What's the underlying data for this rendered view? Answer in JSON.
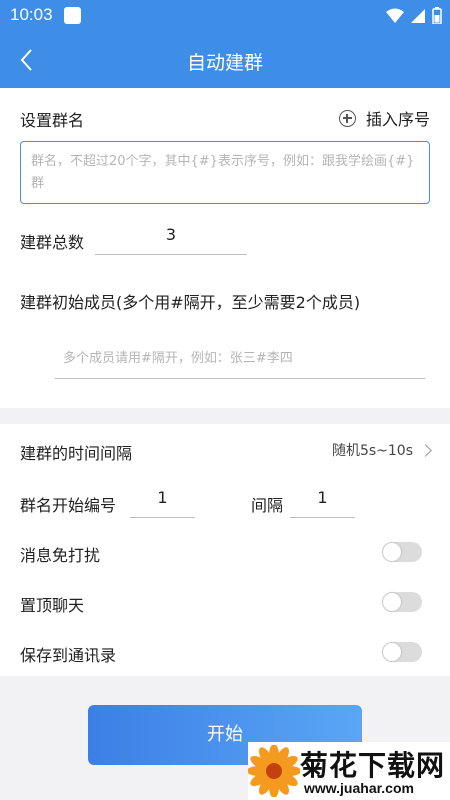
{
  "status_bar": {
    "time": "10:03",
    "icons": [
      "notification-icon",
      "wifi-icon",
      "signal-icon",
      "battery-icon"
    ]
  },
  "app_bar": {
    "title": "自动建群",
    "back_icon": "back-arrow-icon"
  },
  "group_name": {
    "label": "设置群名",
    "insert_label": "插入序号",
    "insert_icon": "plus-circle-icon",
    "placeholder": "群名，不超过20个字，其中{#}表示序号，例如：跟我学绘画{#}群",
    "value": ""
  },
  "total": {
    "label": "建群总数",
    "value": "3"
  },
  "members": {
    "label": "建群初始成员(多个用#隔开，至少需要2个成员)",
    "placeholder": "多个成员请用#隔开，例如：张三#李四"
  },
  "interval": {
    "label": "建群的时间间隔",
    "value": "随机5s~10s"
  },
  "numbering": {
    "start_label": "群名开始编号",
    "start_value": "1",
    "step_label": "间隔",
    "step_value": "1"
  },
  "toggles": [
    {
      "label": "消息免打扰",
      "on": false
    },
    {
      "label": "置顶聊天",
      "on": false
    },
    {
      "label": "保存到通讯录",
      "on": false
    }
  ],
  "start_button": "开始",
  "watermark": {
    "title": "菊花下载网",
    "url": "www.juahar.com"
  },
  "colors": {
    "primary": "#3e8ee8",
    "toggle_off": "#dcdcdc",
    "placeholder": "#b5b5b5"
  }
}
